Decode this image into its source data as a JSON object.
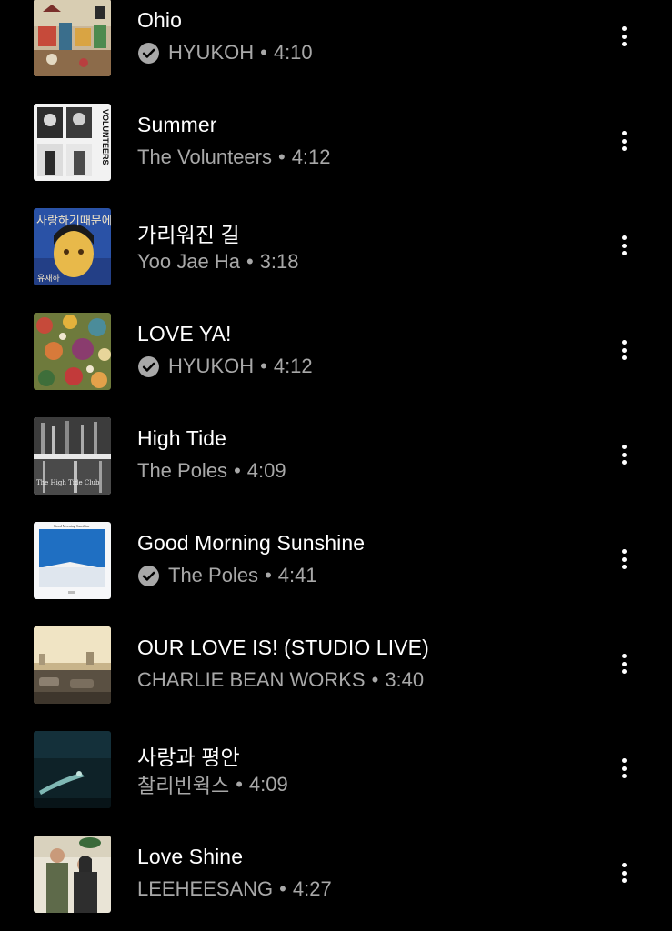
{
  "songs": [
    {
      "title": "Ohio",
      "artist": "HYUKOH",
      "duration": "4:10",
      "verified": true,
      "art": "ohio-art"
    },
    {
      "title": "Summer",
      "artist": "The Volunteers",
      "duration": "4:12",
      "verified": false,
      "art": "volunteers-art"
    },
    {
      "title": "가리워진 길",
      "artist": "Yoo Jae Ha",
      "duration": "3:18",
      "verified": false,
      "art": "yoojaeha-art"
    },
    {
      "title": "LOVE YA!",
      "artist": "HYUKOH",
      "duration": "4:12",
      "verified": true,
      "art": "loveya-art"
    },
    {
      "title": "High Tide",
      "artist": "The Poles",
      "duration": "4:09",
      "verified": false,
      "art": "hightide-art"
    },
    {
      "title": "Good Morning Sunshine",
      "artist": "The Poles",
      "duration": "4:41",
      "verified": true,
      "art": "goodmorning-art"
    },
    {
      "title": "OUR LOVE IS! (STUDIO LIVE)",
      "artist": "CHARLIE BEAN WORKS",
      "duration": "3:40",
      "verified": false,
      "art": "ourloveis-art"
    },
    {
      "title": "사랑과 평안",
      "artist": "찰리빈웍스",
      "duration": "4:09",
      "verified": false,
      "art": "sarang-art"
    },
    {
      "title": "Love Shine",
      "artist": "LEEHEESANG",
      "duration": "4:27",
      "verified": false,
      "art": "loveshine-art"
    }
  ],
  "separator": "•",
  "colors": {
    "background": "#000000",
    "title": "#ffffff",
    "subtitle": "#a8a8a8",
    "verified_badge": "#a8a8a8"
  },
  "album_covers": {
    "volunteers_text": "VOLUNTEERS",
    "yoojaeha_text": "사랑하기때문에",
    "yoojaeha_name": "유재하",
    "hightide_text": "The High Tide Club",
    "goodmorning_text": "Good Morning Sunshine"
  }
}
